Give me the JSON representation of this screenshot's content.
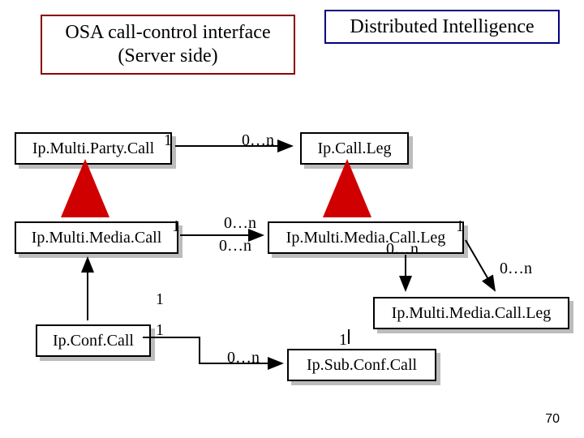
{
  "titles": {
    "left_line1": "OSA call-control interface",
    "left_line2": "(Server side)",
    "right": "Distributed Intelligence"
  },
  "classes": {
    "ipMultiPartyCall": "Ip.Multi.Party.Call",
    "ipCallLeg": "Ip.Call.Leg",
    "ipMultiMediaCall": "Ip.Multi.Media.Call",
    "ipMultiMediaCallLeg": "Ip.Multi.Media.Call.Leg",
    "ipConfCall": "Ip.Conf.Call",
    "ipSubConfCall": "Ip.Sub.Conf.Call",
    "ipMultiMediaCallLeg2": "Ip.Multi.Media.Call.Leg"
  },
  "mult": {
    "one": "1",
    "zero_n": "0…n"
  },
  "page": "70"
}
